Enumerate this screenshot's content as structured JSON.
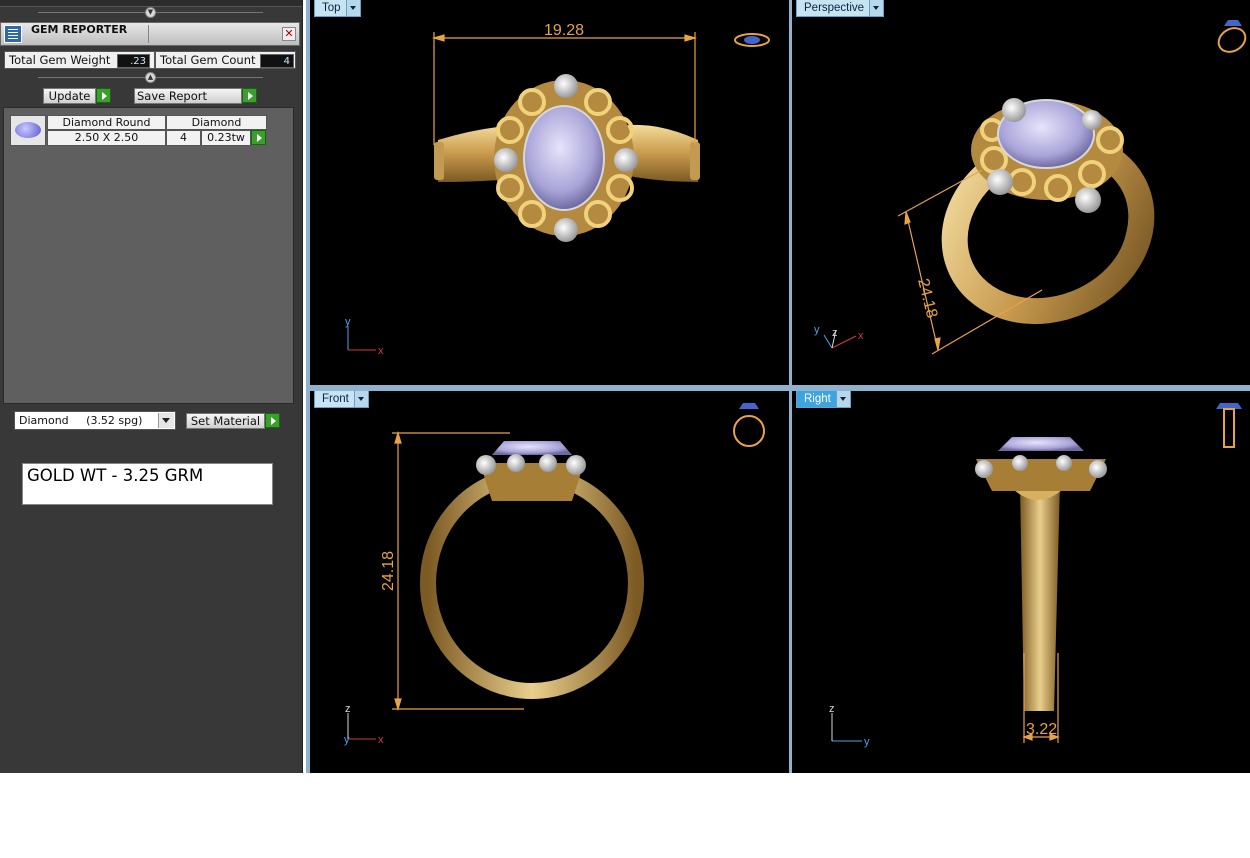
{
  "panel": {
    "title": "GEM REPORTER",
    "close_glyph": "✕",
    "total_weight_label": "Total Gem Weight",
    "total_weight_value": ".23",
    "total_count_label": "Total Gem Count",
    "total_count_value": "4",
    "update_label": "Update",
    "save_report_label": "Save Report",
    "gem_table": {
      "name": "Diamond Round",
      "size": "2.50 X 2.50",
      "material": "Diamond",
      "count": "4",
      "weight": "0.23tw"
    },
    "material_select": "Diamond     (3.52 spg)",
    "set_material_label": "Set Material",
    "note": "GOLD WT - 3.25 GRM"
  },
  "viewports": {
    "top": {
      "label": "Top",
      "dimension": "19.28",
      "axes": [
        "x",
        "y"
      ]
    },
    "perspective": {
      "label": "Perspective",
      "dimension": "24.18",
      "axes": [
        "x",
        "y",
        "z"
      ]
    },
    "front": {
      "label": "Front",
      "dimension": "24.18",
      "axes": [
        "x",
        "y",
        "z"
      ]
    },
    "right": {
      "label": "Right",
      "dimension": "3.22",
      "axes": [
        "y",
        "z"
      ]
    }
  },
  "colors": {
    "gold_light": "#f0d58f",
    "gold_dark": "#8a6a2c",
    "gem": "#b8b4e0",
    "dimension": "#e8a24a",
    "axis_x": "#d23b3b",
    "axis_y": "#4aa3e8",
    "viewport_active": "#3ea4df"
  }
}
